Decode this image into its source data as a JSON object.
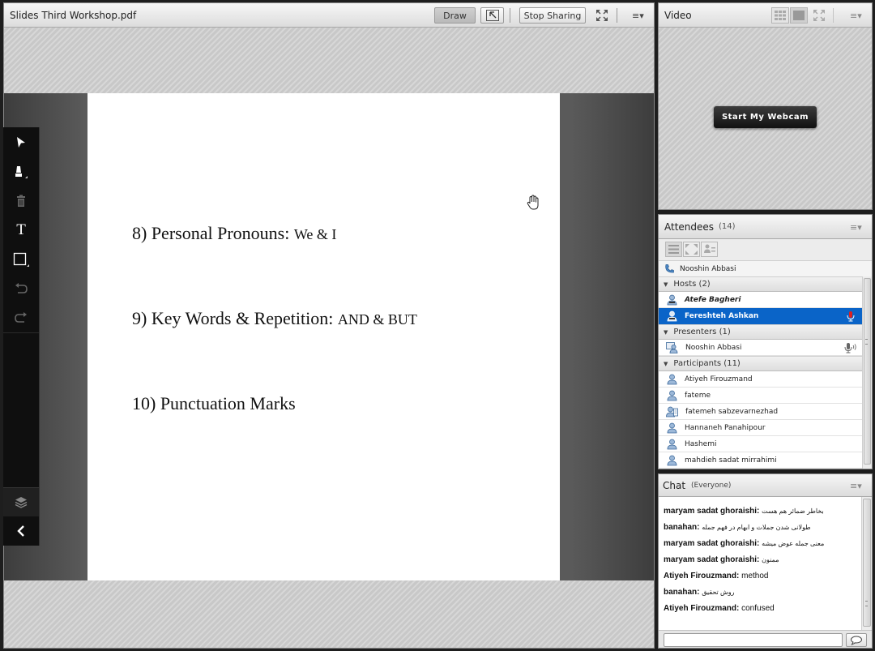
{
  "share_pod": {
    "title": "Slides Third Workshop.pdf",
    "draw_label": "Draw",
    "stop_sharing_label": "Stop Sharing",
    "menu_icon": "menu-icon"
  },
  "slide": {
    "lines": [
      {
        "main": "8) Personal Pronouns:",
        "small": "We & I"
      },
      {
        "main": "9) Key Words & Repetition:",
        "small": "AND & BUT"
      },
      {
        "main": "10) Punctuation Marks",
        "small": ""
      }
    ]
  },
  "toolbar": {
    "tools": [
      "pointer-tool-icon",
      "highlighter-tool-icon",
      "delete-tool-icon",
      "text-tool-icon",
      "shape-tool-icon",
      "undo-icon",
      "redo-icon",
      "layers-icon",
      "collapse-toolbar-icon"
    ],
    "text_tool_glyph": "T"
  },
  "video_pod": {
    "title": "Video",
    "start_webcam_label": "Start My Webcam"
  },
  "attendees_pod": {
    "title": "Attendees",
    "count": "(14)",
    "phone_user": "Nooshin Abbasi",
    "groups": [
      {
        "label": "Hosts (2)",
        "members": [
          "Atefe Bagheri",
          "Fereshteh Ashkan"
        ]
      },
      {
        "label": "Presenters (1)",
        "members": [
          "Nooshin Abbasi"
        ]
      },
      {
        "label": "Participants (11)",
        "members": [
          "Atiyeh Firouzmand",
          "fateme",
          "fatemeh sabzevarnezhad",
          "Hannaneh Panahipour",
          "Hashemi",
          "mahdieh sadat mirrahimi"
        ]
      }
    ],
    "selected_member": "Fereshteh Ashkan"
  },
  "chat_pod": {
    "title": "Chat",
    "scope": "(Everyone)",
    "messages": [
      {
        "sender": "maryam sadat ghoraishi:",
        "text": "بخاطر ضمائر هم هست"
      },
      {
        "sender": "banahan:",
        "text": "طولانی شدن جملات و ابهام در فهم جمله"
      },
      {
        "sender": "maryam sadat ghoraishi:",
        "text": "معنی جمله عوض میشه"
      },
      {
        "sender": "maryam sadat ghoraishi:",
        "text": "ممنون"
      },
      {
        "sender": "Atiyeh Firouzmand:",
        "text": "method"
      },
      {
        "sender": "banahan:",
        "text": "روش تحقیق"
      },
      {
        "sender": "Atiyeh Firouzmand:",
        "text": "confused"
      }
    ],
    "input_placeholder": ""
  },
  "colors": {
    "selection": "#0a64c8",
    "toolbar_bg": "#0f0f0f",
    "pod_border": "#8a8a8a"
  }
}
